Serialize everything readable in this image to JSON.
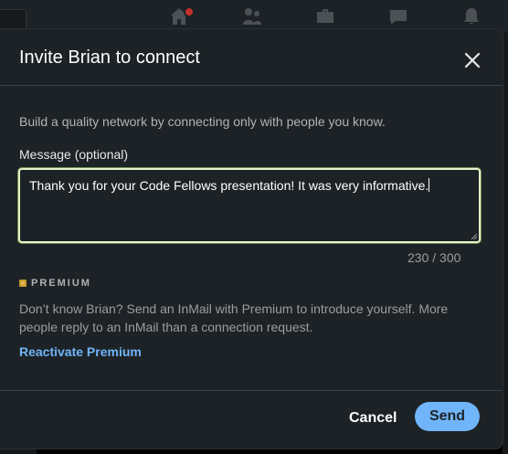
{
  "background_nav": {
    "icons": [
      "home-icon",
      "my-network-icon",
      "jobs-icon",
      "messaging-icon",
      "notifications-icon"
    ]
  },
  "dialog": {
    "title": "Invite Brian to connect",
    "close_icon": "close-icon",
    "intro": "Build a quality network by connecting only with people you know.",
    "message_label": "Message (optional)",
    "message_value": "Thank you for your Code Fellows presentation! It was very informative.",
    "counter": "230 / 300",
    "premium": {
      "label": "PREMIUM",
      "text": "Don’t know Brian? Send an InMail with Premium to introduce yourself. More people reply to an InMail than a connection request.",
      "link": "Reactivate Premium"
    },
    "footer": {
      "cancel_label": "Cancel",
      "send_label": "Send"
    }
  },
  "colors": {
    "modal_bg": "#1d2226",
    "accent_blue": "#70b5f9",
    "focus_border": "#e4f2c8",
    "premium_gold": "#c79a2f",
    "notification_red": "#c4302b"
  }
}
